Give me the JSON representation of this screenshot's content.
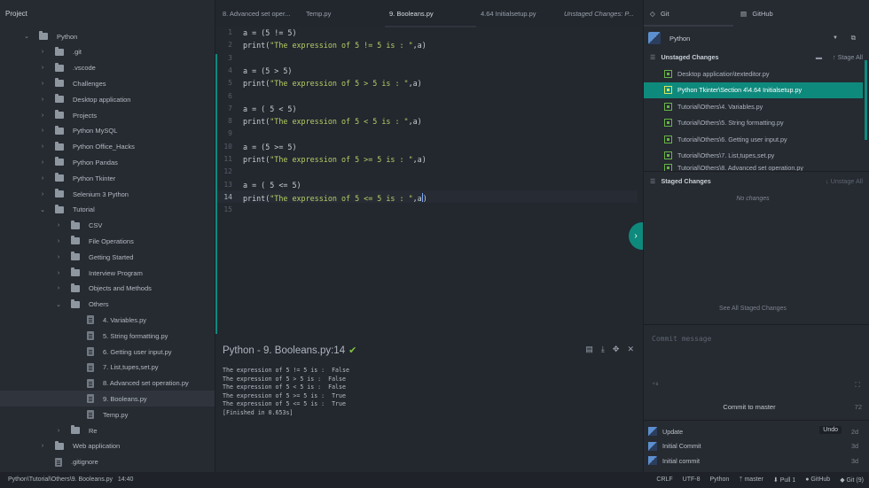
{
  "project": {
    "title": "Project",
    "items": [
      {
        "label": "Python",
        "type": "folder",
        "expanded": true
      },
      {
        "label": ".git",
        "type": "folder"
      },
      {
        "label": ".vscode",
        "type": "folder"
      },
      {
        "label": "Challenges",
        "type": "folder"
      },
      {
        "label": "Desktop application",
        "type": "folder"
      },
      {
        "label": "Projects",
        "type": "folder"
      },
      {
        "label": "Python MySQL",
        "type": "folder"
      },
      {
        "label": "Python Office_Hacks",
        "type": "folder"
      },
      {
        "label": "Python Pandas",
        "type": "folder"
      },
      {
        "label": "Python Tkinter",
        "type": "folder"
      },
      {
        "label": "Selenium 3 Python",
        "type": "folder"
      },
      {
        "label": "Tutorial",
        "type": "folder",
        "expanded": true
      },
      {
        "label": "CSV",
        "type": "folder"
      },
      {
        "label": "File Operations",
        "type": "folder"
      },
      {
        "label": "Getting Started",
        "type": "folder"
      },
      {
        "label": "Interview Program",
        "type": "folder"
      },
      {
        "label": "Objects and Methods",
        "type": "folder"
      },
      {
        "label": "Others",
        "type": "folder",
        "expanded": true
      },
      {
        "label": "4. Variables.py",
        "type": "file"
      },
      {
        "label": "5. String formatting.py",
        "type": "file"
      },
      {
        "label": "6. Getting user input.py",
        "type": "file"
      },
      {
        "label": "7. List,tupes,set.py",
        "type": "file"
      },
      {
        "label": "8. Advanced set operation.py",
        "type": "file"
      },
      {
        "label": "9. Booleans.py",
        "type": "file",
        "selected": true
      },
      {
        "label": "Temp.py",
        "type": "file"
      },
      {
        "label": "Re",
        "type": "folder"
      },
      {
        "label": "Web application",
        "type": "folder"
      },
      {
        "label": ".gitignore",
        "type": "file"
      }
    ]
  },
  "tabs": [
    {
      "label": "8. Advanced set oper..."
    },
    {
      "label": "Temp.py"
    },
    {
      "label": "9. Booleans.py",
      "active": true
    },
    {
      "label": "4.64 Initialsetup.py"
    },
    {
      "label": "Unstaged Changes: P..."
    }
  ],
  "editor": {
    "line_numbers": [
      "1",
      "2",
      "3",
      "4",
      "5",
      "6",
      "7",
      "8",
      "9",
      "10",
      "11",
      "12",
      "13",
      "14",
      "15"
    ],
    "current_line": "14",
    "lines": [
      [
        "a = (5 != 5)",
        ""
      ],
      [
        "print(",
        "\"The expression of 5 != 5 is : \"",
        ",a)"
      ],
      [
        "",
        ""
      ],
      [
        "a = (5 > 5)",
        ""
      ],
      [
        "print(",
        "\"The expression of 5 > 5 is : \"",
        ",a)"
      ],
      [
        "",
        ""
      ],
      [
        "a = ( 5 < 5)",
        ""
      ],
      [
        "print(",
        "\"The expression of 5 < 5 is : \"",
        ",a)"
      ],
      [
        "",
        ""
      ],
      [
        "a = (5 >= 5)",
        ""
      ],
      [
        "print(",
        "\"The expression of 5 >= 5 is : \"",
        ",a)"
      ],
      [
        "",
        ""
      ],
      [
        "a = ( 5 <= 5)",
        ""
      ],
      [
        "print(",
        "\"The expression of 5 <= 5 is : \"",
        ",a)"
      ],
      [
        "",
        ""
      ]
    ]
  },
  "output": {
    "title": "Python - 9. Booleans.py:14",
    "lines": "The expression of 5 != 5 is :  False\nThe expression of 5 > 5 is :  False\nThe expression of 5 < 5 is :  False\nThe expression of 5 >= 5 is :  True\nThe expression of 5 <= 5 is :  True\n[Finished in 0.653s]"
  },
  "git": {
    "tab_git": "Git",
    "tab_github": "GitHub",
    "repo": "Python",
    "unstaged_title": "Unstaged Changes",
    "stage_all": "Stage All",
    "unstaged": [
      "Desktop application\\texteditor.py",
      "Python Tkinter\\Section 4\\4.64 Initialsetup.py",
      "Tutorial\\Others\\4. Variables.py",
      "Tutorial\\Others\\5. String formatting.py",
      "Tutorial\\Others\\6. Getting user input.py",
      "Tutorial\\Others\\7. List,tupes,set.py",
      "Tutorial\\Others\\8. Advanced set operation.py"
    ],
    "staged_title": "Staged Changes",
    "unstage_all": "Unstage All",
    "no_changes": "No changes",
    "see_all_staged": "See All Staged Changes",
    "commit_placeholder": "Commit message",
    "commit_button": "Commit to master",
    "commit_count": "72",
    "recent": [
      {
        "message": "Update",
        "time": "2d",
        "undo": "Undo"
      },
      {
        "message": "Initial Commit",
        "time": "3d"
      },
      {
        "message": "Initial commit",
        "time": "3d"
      }
    ]
  },
  "status": {
    "path": "Python\\Tutorial\\Others\\9. Booleans.py",
    "cursor": "14:40",
    "line_ending": "CRLF",
    "encoding": "UTF-8",
    "grammar": "Python",
    "branch": "master",
    "pull": "Pull 1",
    "github": "GitHub",
    "git": "Git (9)"
  },
  "colors": {
    "accent": "#0e8a7d",
    "string": "#b4cf65",
    "check": "#7fc142"
  }
}
